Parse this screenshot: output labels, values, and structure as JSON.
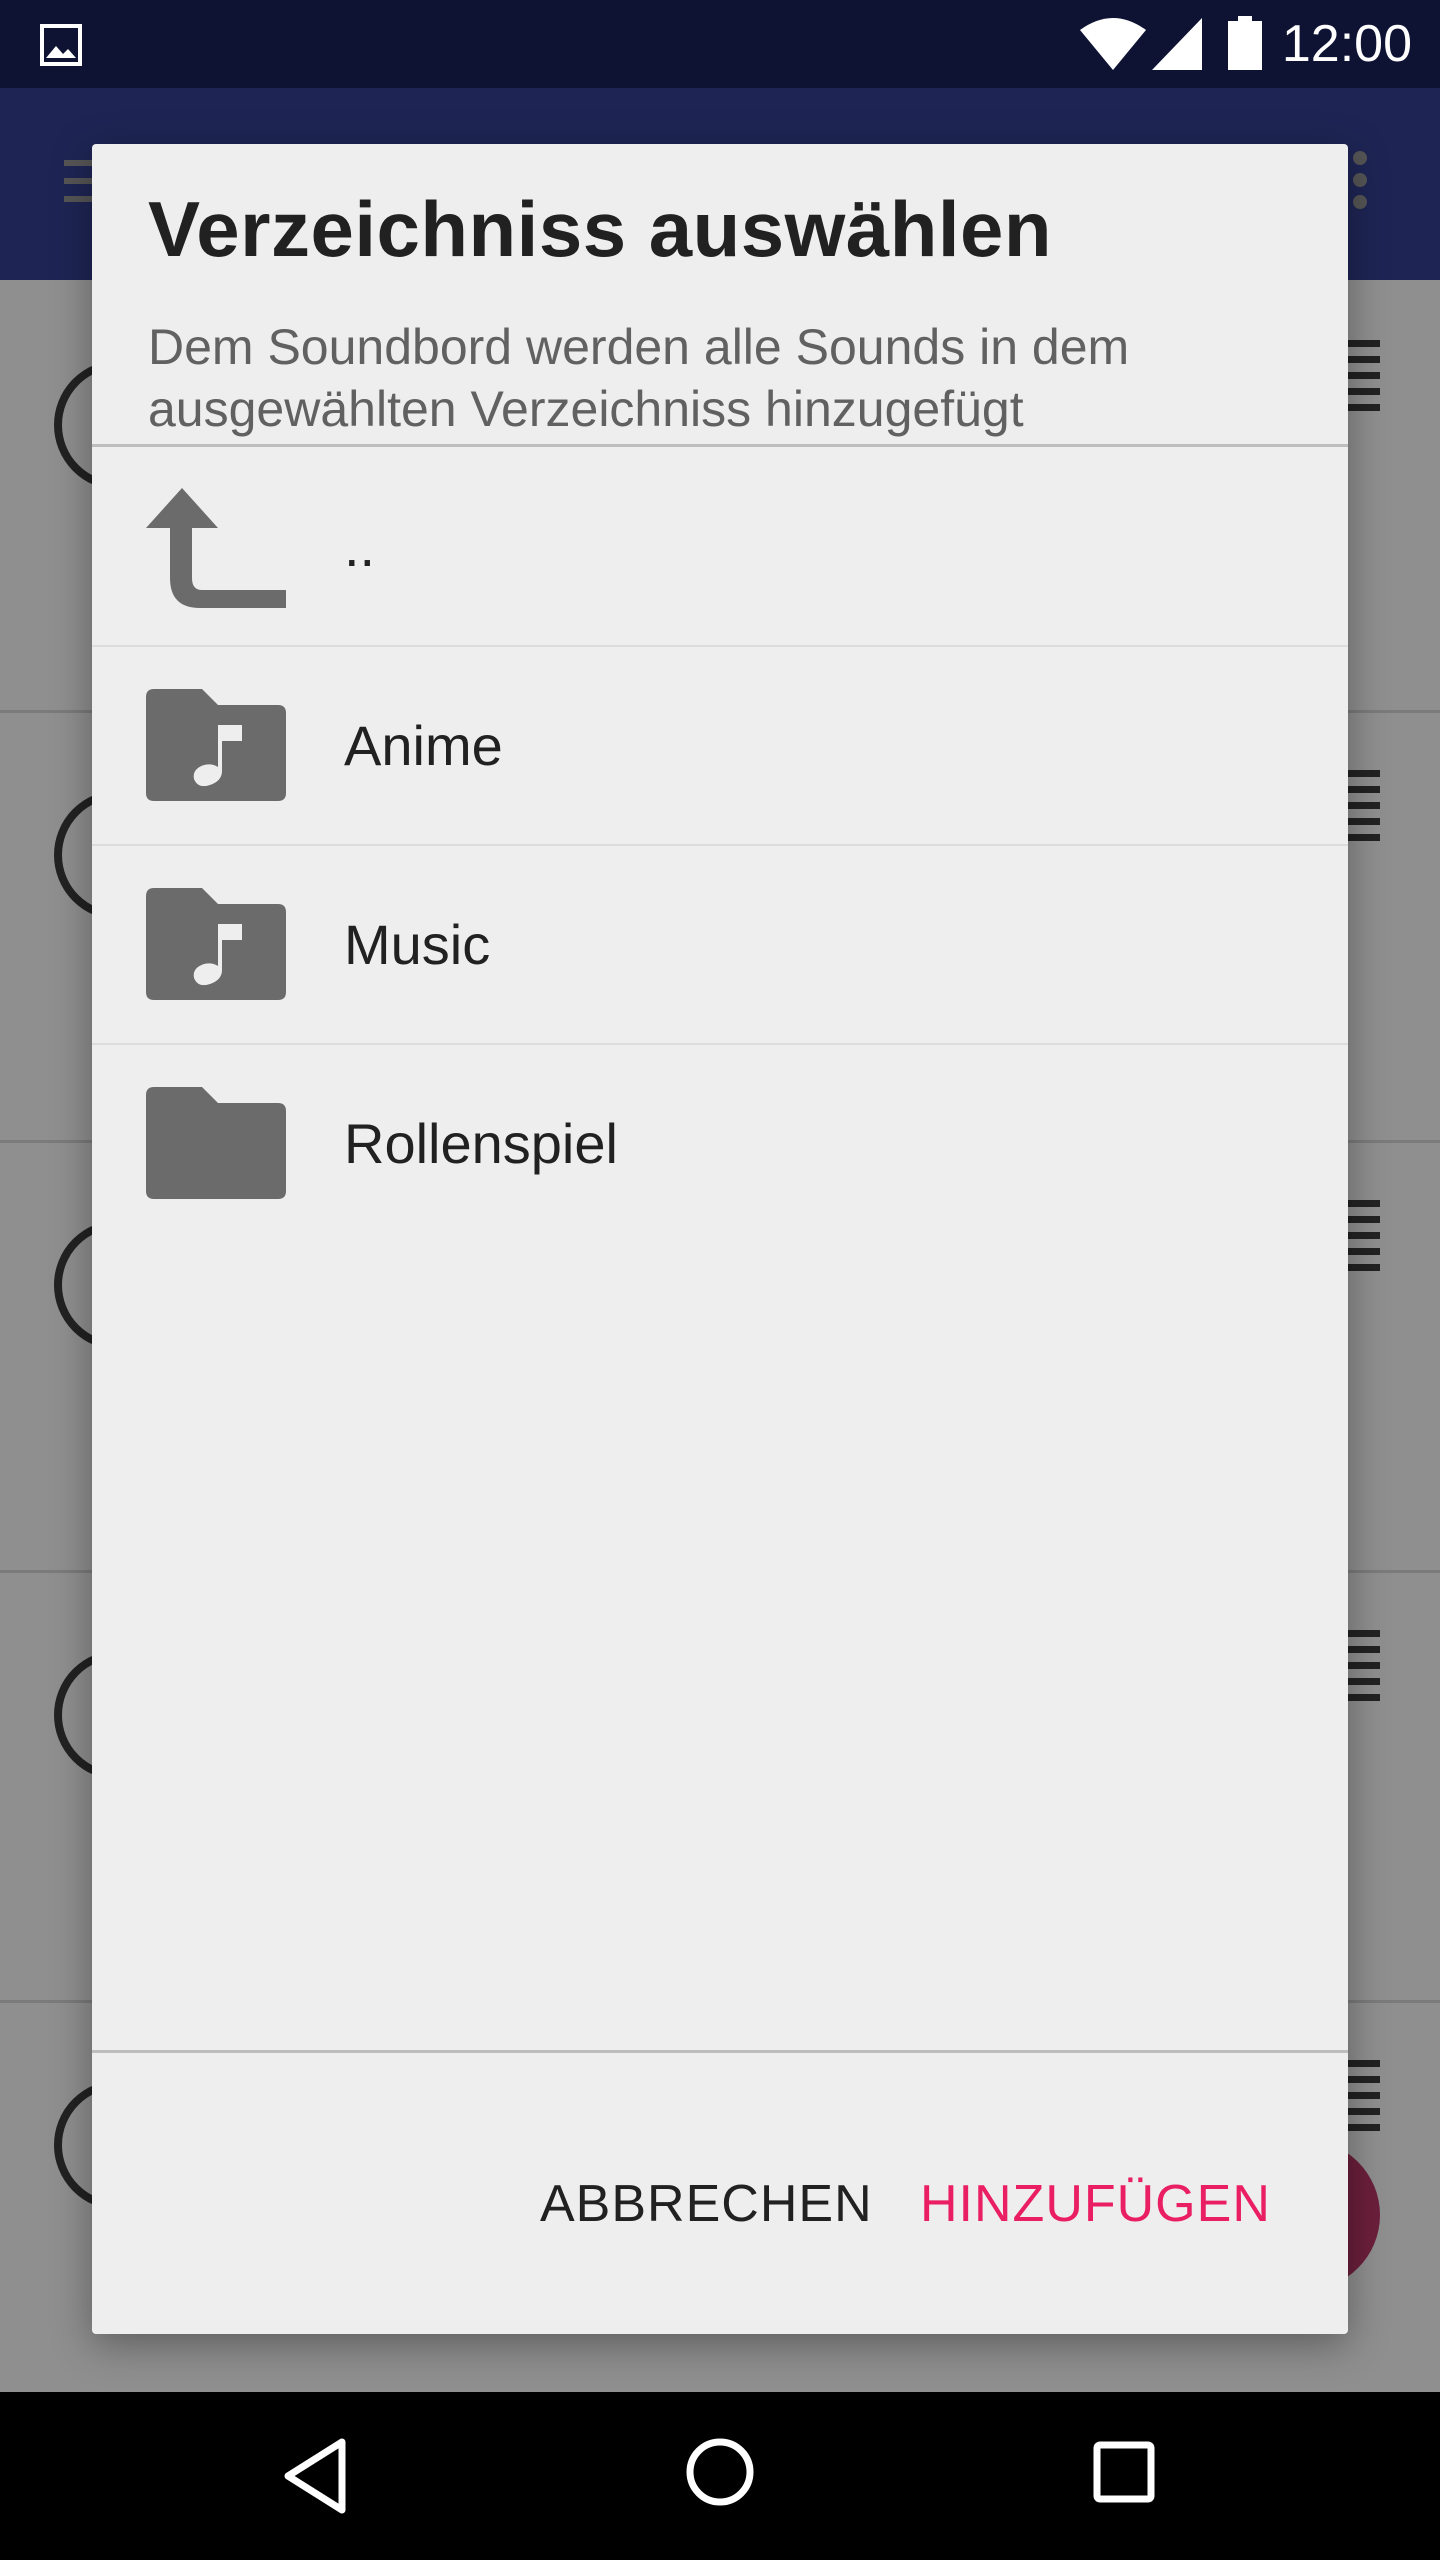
{
  "status_bar": {
    "time": "12:00",
    "icons": [
      "image-icon",
      "wifi-icon",
      "signal-icon",
      "battery-icon"
    ]
  },
  "dialog": {
    "title": "Verzeichniss auswählen",
    "subtitle": "Dem Soundbord werden alle Sounds in dem ausgewählten Verzeichniss hinzugefügt",
    "items": [
      {
        "label": "..",
        "icon": "parent-directory-icon"
      },
      {
        "label": "Anime",
        "icon": "music-folder-icon"
      },
      {
        "label": "Music",
        "icon": "music-folder-icon"
      },
      {
        "label": "Rollenspiel",
        "icon": "folder-icon"
      }
    ],
    "buttons": {
      "cancel": "ABBRECHEN",
      "add": "HINZUFÜGEN"
    }
  },
  "colors": {
    "accent": "#e91e63",
    "status_bar": "#0e1333",
    "icon_gray": "#6b6b6b"
  },
  "nav_bar": {
    "icons": [
      "back-icon",
      "home-icon",
      "recents-icon"
    ]
  }
}
